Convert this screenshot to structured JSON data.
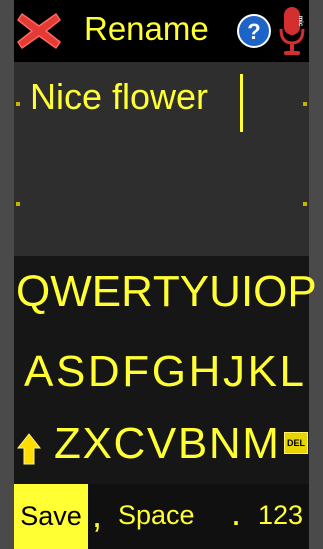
{
  "header": {
    "title": "Rename",
    "close_icon": "close-x-icon",
    "help_icon": "help-question-icon",
    "mic_icon": "microphone-icon",
    "mic_label": "mic"
  },
  "text_input": {
    "value": "Nice flower"
  },
  "keyboard": {
    "row1": [
      "Q",
      "W",
      "E",
      "R",
      "T",
      "Y",
      "U",
      "I",
      "O",
      "P"
    ],
    "row2": [
      "A",
      "S",
      "D",
      "F",
      "G",
      "H",
      "J",
      "K",
      "L"
    ],
    "row3": [
      "Z",
      "X",
      "C",
      "V",
      "B",
      "N",
      "M"
    ],
    "shift_icon": "shift-arrow-icon",
    "del_label": "DEL",
    "save_label": "Save",
    "comma": ",",
    "space_label": "Space",
    "period": ".",
    "numbers_label": "123"
  },
  "colors": {
    "accent": "#ffff33",
    "close_red": "#e53935",
    "help_blue": "#1e63c8",
    "mic_red": "#d32f2f",
    "background": "#000000",
    "textarea_bg": "#2e2e2e",
    "frame": "#4a4a4a"
  }
}
